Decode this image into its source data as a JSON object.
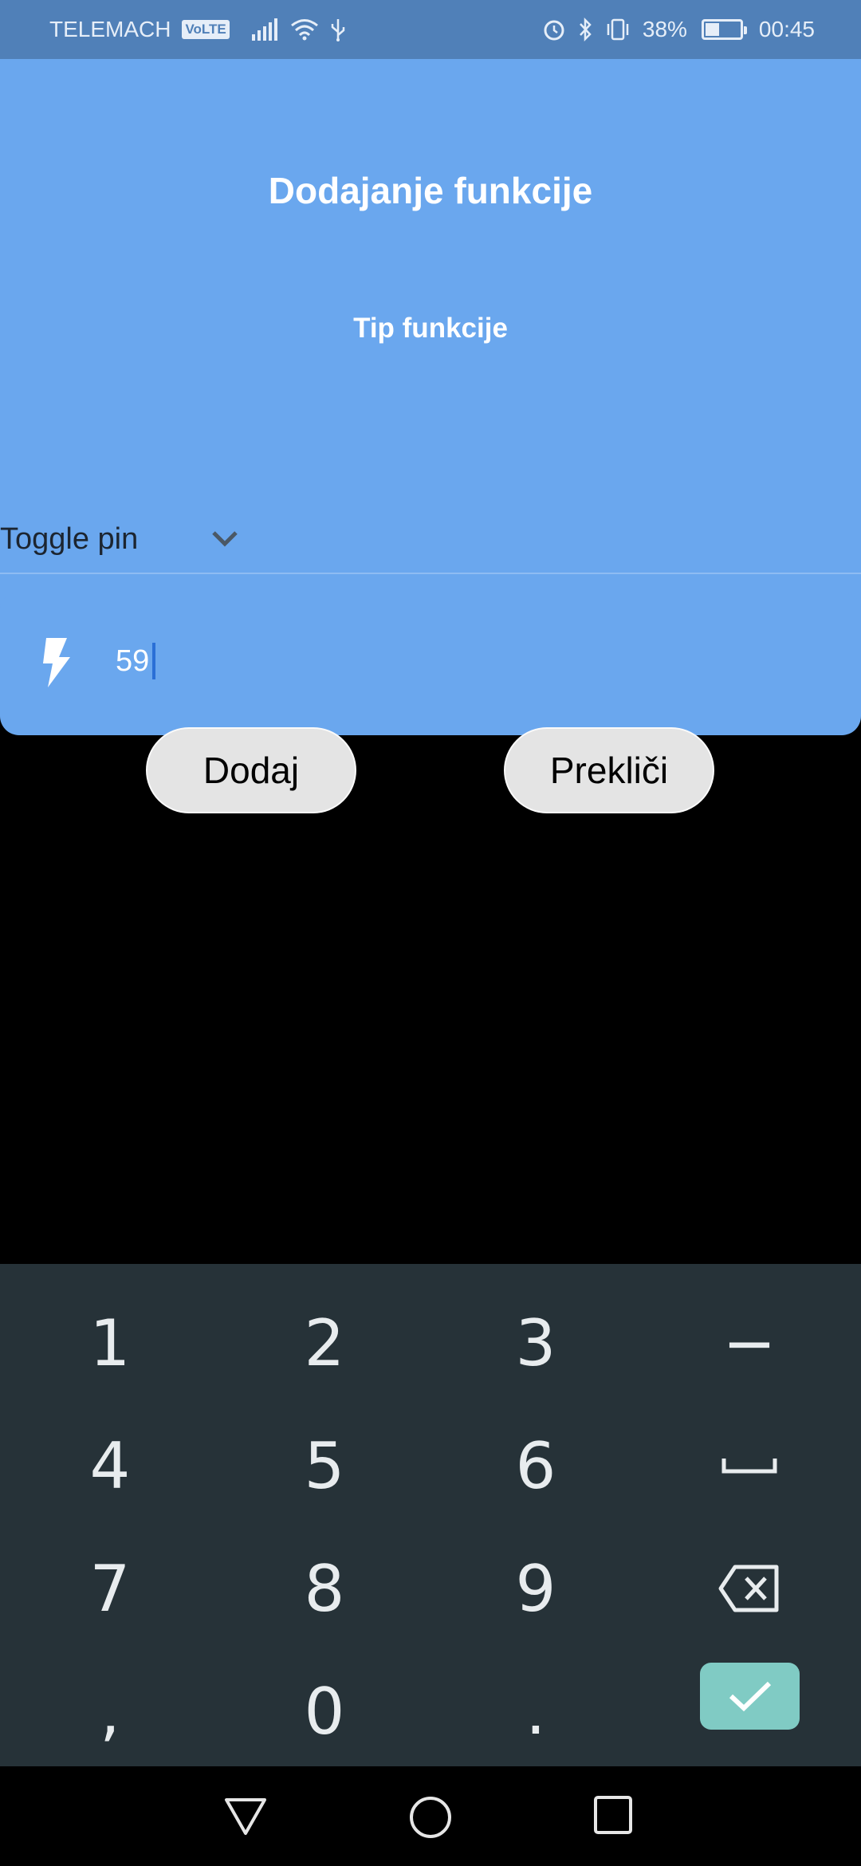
{
  "status_bar": {
    "carrier": "TELEMACH",
    "volte": "VoLTE",
    "battery": "38%",
    "battery_level": 0.38,
    "time": "00:45",
    "icons": [
      "signal-icon",
      "wifi-icon",
      "usb-icon",
      "alarm-icon",
      "bluetooth-icon",
      "vibrate-icon",
      "battery-icon"
    ]
  },
  "dialog": {
    "title": "Dodajanje funkcije",
    "subtitle": "Tip funkcije",
    "dropdown_value": "Toggle pin",
    "input_value": "59",
    "input_icon": "bolt-icon",
    "colors": {
      "panel": "#6aa7ee",
      "status_bar": "#5080b8"
    }
  },
  "buttons": {
    "add": "Dodaj",
    "cancel": "Prekliči"
  },
  "keyboard": {
    "keys": [
      "1",
      "2",
      "3",
      "−",
      "4",
      "5",
      "6",
      "space",
      "7",
      "8",
      "9",
      "backspace",
      ",",
      "0",
      ".",
      "done"
    ],
    "labels": {
      "k1": "1",
      "k2": "2",
      "k3": "3",
      "kminus": "−",
      "k4": "4",
      "k5": "5",
      "k6": "6",
      "k7": "7",
      "k8": "8",
      "k9": "9",
      "kcomma": ",",
      "k0": "0",
      "kdot": "."
    },
    "colors": {
      "background": "#263238",
      "done": "#80cbc4"
    }
  },
  "navbar": {
    "icons": [
      "back-icon",
      "home-icon",
      "recents-icon"
    ]
  }
}
